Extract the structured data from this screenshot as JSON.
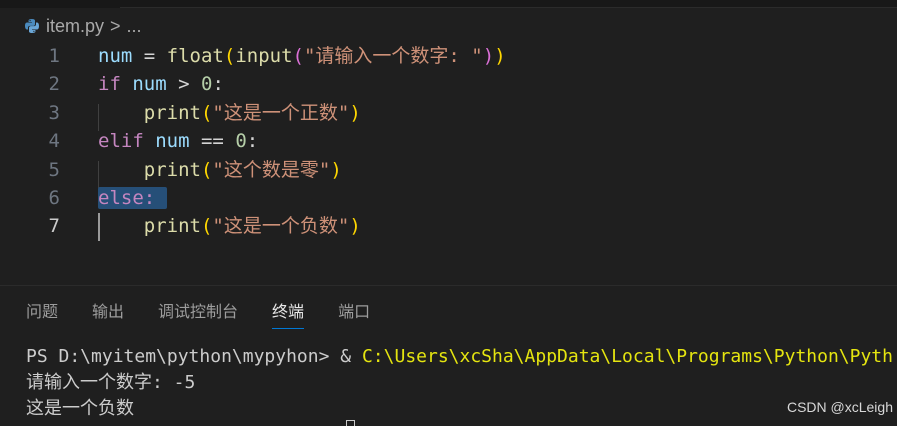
{
  "breadcrumb": {
    "file": "item.py",
    "separator": ">",
    "more": "..."
  },
  "editor": {
    "active_line": "7",
    "lines": [
      {
        "num": "1",
        "t": [
          {
            "text": "num",
            "cls": "var"
          },
          {
            "text": " = ",
            "cls": "op"
          },
          {
            "text": "float",
            "cls": "fn"
          },
          {
            "text": "(",
            "cls": "paren"
          },
          {
            "text": "input",
            "cls": "fn"
          },
          {
            "text": "(",
            "cls": "paren2"
          },
          {
            "text": "\"请输入一个数字: \"",
            "cls": "str"
          },
          {
            "text": ")",
            "cls": "paren2"
          },
          {
            "text": ")",
            "cls": "paren"
          }
        ]
      },
      {
        "num": "2",
        "t": [
          {
            "text": "if",
            "cls": "kw"
          },
          {
            "text": " ",
            "cls": "op"
          },
          {
            "text": "num",
            "cls": "var"
          },
          {
            "text": " > ",
            "cls": "op"
          },
          {
            "text": "0",
            "cls": "num"
          },
          {
            "text": ":",
            "cls": "op"
          }
        ]
      },
      {
        "num": "3",
        "t": [
          {
            "text": "    ",
            "cls": "op"
          },
          {
            "text": "print",
            "cls": "fn"
          },
          {
            "text": "(",
            "cls": "paren"
          },
          {
            "text": "\"这是一个正数\"",
            "cls": "str"
          },
          {
            "text": ")",
            "cls": "paren"
          }
        ]
      },
      {
        "num": "4",
        "t": [
          {
            "text": "elif",
            "cls": "kw"
          },
          {
            "text": " ",
            "cls": "op"
          },
          {
            "text": "num",
            "cls": "var"
          },
          {
            "text": " == ",
            "cls": "op"
          },
          {
            "text": "0",
            "cls": "num"
          },
          {
            "text": ":",
            "cls": "op"
          }
        ]
      },
      {
        "num": "5",
        "t": [
          {
            "text": "    ",
            "cls": "op"
          },
          {
            "text": "print",
            "cls": "fn"
          },
          {
            "text": "(",
            "cls": "paren"
          },
          {
            "text": "\"这个数是零\"",
            "cls": "str"
          },
          {
            "text": ")",
            "cls": "paren"
          }
        ]
      },
      {
        "num": "6",
        "t": [
          {
            "text": "else:",
            "cls": "kw sel"
          }
        ]
      },
      {
        "num": "7",
        "t": [
          {
            "text": "    ",
            "cls": "op"
          },
          {
            "text": "print",
            "cls": "fn"
          },
          {
            "text": "(",
            "cls": "paren"
          },
          {
            "text": "\"这是一个负数\"",
            "cls": "str"
          },
          {
            "text": ")",
            "cls": "paren"
          }
        ]
      }
    ]
  },
  "panel": {
    "tabs": [
      "问题",
      "输出",
      "调试控制台",
      "终端",
      "端口"
    ],
    "active_tab": "终端"
  },
  "terminal": {
    "prompt": "PS D:\\myitem\\python\\mypyhon> ",
    "amp": "& ",
    "cmd": "C:\\Users\\xcSha\\AppData\\Local\\Programs\\Python\\Pyth",
    "out1": "请输入一个数字: -5",
    "out2": "这是一个负数"
  },
  "watermark": "CSDN @xcLeigh"
}
